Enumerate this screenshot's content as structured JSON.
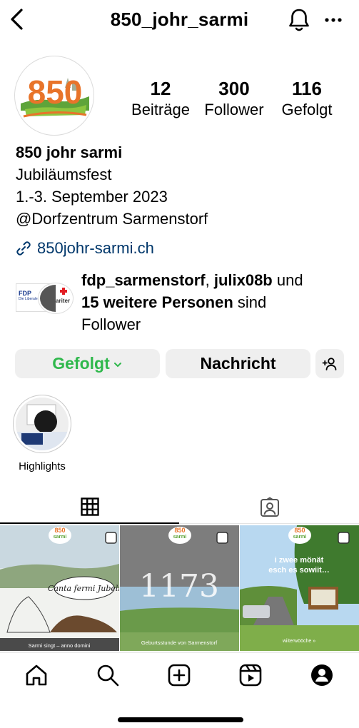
{
  "header": {
    "username": "850_johr_sarmi",
    "back_icon": "chevron-left-icon",
    "bell_icon": "bell-icon",
    "more_icon": "more-horizontal-icon"
  },
  "profile": {
    "avatar_text": "850",
    "stats": [
      {
        "value": "12",
        "label": "Beiträge"
      },
      {
        "value": "300",
        "label": "Follower"
      },
      {
        "value": "116",
        "label": "Gefolgt"
      }
    ],
    "name": "850 johr sarmi",
    "bio_lines": [
      "Jubiläumsfest",
      "1.-3. September 2023",
      "@Dorfzentrum Sarmenstorf"
    ],
    "link": "850johr-sarmi.ch"
  },
  "followed_by": {
    "user1": "fdp_sarmenstorf",
    "sep": ", ",
    "user2": "julix08b",
    "and": " und",
    "others": "15 weitere Personen",
    "suffix": " sind",
    "suffix2": "Follower",
    "avatar1_text": "FDP",
    "avatar1_sub": "Die Liberalen",
    "avatar2_text": "ariter"
  },
  "actions": {
    "follow_label": "Gefolgt",
    "message_label": "Nachricht",
    "follow_color": "#2fb84c"
  },
  "highlights": [
    {
      "label": "Highlights"
    }
  ],
  "tabs": [
    {
      "icon": "grid-icon",
      "active": true
    },
    {
      "icon": "tagged-icon",
      "active": false
    }
  ],
  "posts": [
    {
      "caption": "Sarmi singt – anno domini",
      "handwriting": "Canta fermi Jubeli"
    },
    {
      "caption": "Geburtsstunde von Sarmenstorf",
      "big_text": "1173"
    },
    {
      "caption": "wiiterwööche »",
      "text_lines": [
        "i zwee mönät",
        "esch es sowiit…"
      ]
    }
  ],
  "post_logo_text": "850",
  "post_logo_sub": "sarmi",
  "bottom_nav": [
    "home-icon",
    "search-icon",
    "create-icon",
    "reels-icon",
    "profile-icon"
  ],
  "colors": {
    "link": "#00376b",
    "button_bg": "#efefef",
    "logo_orange": "#e8742a",
    "logo_green": "#5ea43a"
  }
}
